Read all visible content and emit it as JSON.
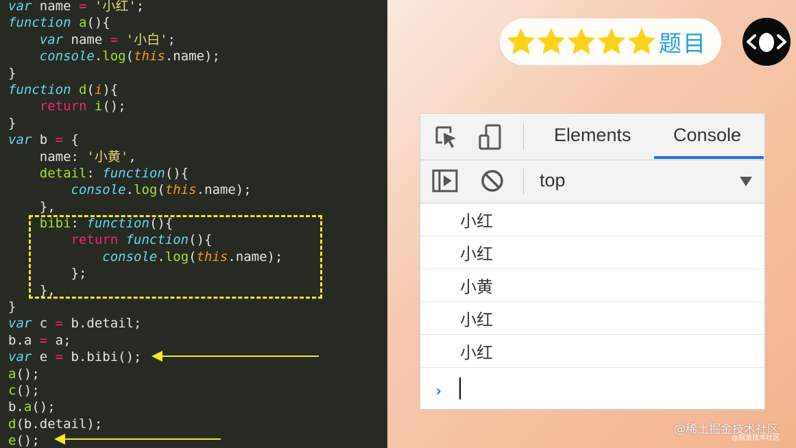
{
  "code": {
    "lines": [
      [
        [
          "kw",
          "var"
        ],
        [
          "pn",
          " name "
        ],
        [
          "op",
          "="
        ],
        [
          "pn",
          " "
        ],
        [
          "str",
          "'小红'"
        ],
        [
          "pn",
          ";"
        ]
      ],
      [
        [
          "kw",
          "function"
        ],
        [
          "pn",
          " "
        ],
        [
          "fn",
          "a"
        ],
        [
          "pn",
          "(){"
        ]
      ],
      [
        [
          "pn",
          "    "
        ],
        [
          "kw",
          "var"
        ],
        [
          "pn",
          " name "
        ],
        [
          "op",
          "="
        ],
        [
          "pn",
          " "
        ],
        [
          "str",
          "'小白'"
        ],
        [
          "pn",
          ";"
        ]
      ],
      [
        [
          "pn",
          "    "
        ],
        [
          "cn",
          "console"
        ],
        [
          "pn",
          "."
        ],
        [
          "fn",
          "log"
        ],
        [
          "pn",
          "("
        ],
        [
          "this",
          "this"
        ],
        [
          "pn",
          ".name);"
        ]
      ],
      [
        [
          "pn",
          "}"
        ]
      ],
      [
        [
          "kw",
          "function"
        ],
        [
          "pn",
          " "
        ],
        [
          "fn",
          "d"
        ],
        [
          "pn",
          "("
        ],
        [
          "prm",
          "i"
        ],
        [
          "pn",
          "){"
        ]
      ],
      [
        [
          "pn",
          "    "
        ],
        [
          "op",
          "return"
        ],
        [
          "pn",
          " "
        ],
        [
          "fn",
          "i"
        ],
        [
          "pn",
          "();"
        ]
      ],
      [
        [
          "pn",
          "}"
        ]
      ],
      [
        [
          "kw",
          "var"
        ],
        [
          "pn",
          " b "
        ],
        [
          "op",
          "="
        ],
        [
          "pn",
          " {"
        ]
      ],
      [
        [
          "pn",
          "    name: "
        ],
        [
          "str",
          "'小黄'"
        ],
        [
          "pn",
          ","
        ]
      ],
      [
        [
          "pn",
          "    "
        ],
        [
          "prop",
          "detail"
        ],
        [
          "pn",
          ": "
        ],
        [
          "kw",
          "function"
        ],
        [
          "pn",
          "(){"
        ]
      ],
      [
        [
          "pn",
          "        "
        ],
        [
          "cn",
          "console"
        ],
        [
          "pn",
          "."
        ],
        [
          "fn",
          "log"
        ],
        [
          "pn",
          "("
        ],
        [
          "this",
          "this"
        ],
        [
          "pn",
          ".name);"
        ]
      ],
      [
        [
          "pn",
          "    },"
        ]
      ],
      [
        [
          "pn",
          "    "
        ],
        [
          "prop",
          "bibi"
        ],
        [
          "pn",
          ": "
        ],
        [
          "kw",
          "function"
        ],
        [
          "pn",
          "(){"
        ]
      ],
      [
        [
          "pn",
          "        "
        ],
        [
          "op",
          "return"
        ],
        [
          "pn",
          " "
        ],
        [
          "kw",
          "function"
        ],
        [
          "pn",
          "(){"
        ]
      ],
      [
        [
          "pn",
          "            "
        ],
        [
          "cn",
          "console"
        ],
        [
          "pn",
          "."
        ],
        [
          "fn",
          "log"
        ],
        [
          "pn",
          "("
        ],
        [
          "this",
          "this"
        ],
        [
          "pn",
          ".name);"
        ]
      ],
      [
        [
          "pn",
          "        };"
        ]
      ],
      [
        [
          "pn",
          "    },"
        ]
      ],
      [
        [
          "pn",
          "}"
        ]
      ],
      [
        [
          "kw",
          "var"
        ],
        [
          "pn",
          " c "
        ],
        [
          "op",
          "="
        ],
        [
          "pn",
          " b.detail;"
        ]
      ],
      [
        [
          "pn",
          "b.a "
        ],
        [
          "op",
          "="
        ],
        [
          "pn",
          " a;"
        ]
      ],
      [
        [
          "kw",
          "var"
        ],
        [
          "pn",
          " e "
        ],
        [
          "op",
          "="
        ],
        [
          "pn",
          " b.bibi();"
        ]
      ],
      [
        [
          "fn",
          "a"
        ],
        [
          "pn",
          "();"
        ]
      ],
      [
        [
          "fn",
          "c"
        ],
        [
          "pn",
          "();"
        ]
      ],
      [
        [
          "pn",
          "b."
        ],
        [
          "fn",
          "a"
        ],
        [
          "pn",
          "();"
        ]
      ],
      [
        [
          "fn",
          "d"
        ],
        [
          "pn",
          "(b.detail);"
        ]
      ],
      [
        [
          "fn",
          "e"
        ],
        [
          "pn",
          "();"
        ]
      ]
    ]
  },
  "badge": {
    "stars": 5,
    "text": "题目",
    "star_color": "#ffd21a",
    "text_color": "#1f9fe3"
  },
  "logo": {
    "icon": "angle-brackets-egg-logo"
  },
  "devtools": {
    "tabs": [
      "Elements",
      "Console"
    ],
    "active_tab": "Console",
    "context": "top",
    "messages": [
      "小红",
      "小红",
      "小黄",
      "小红",
      "小红"
    ],
    "prompt_symbol": "›",
    "accent": "#1a73e8"
  },
  "watermark": "@稀土掘金技术社区",
  "watermark_small": "@掘金技术社区"
}
